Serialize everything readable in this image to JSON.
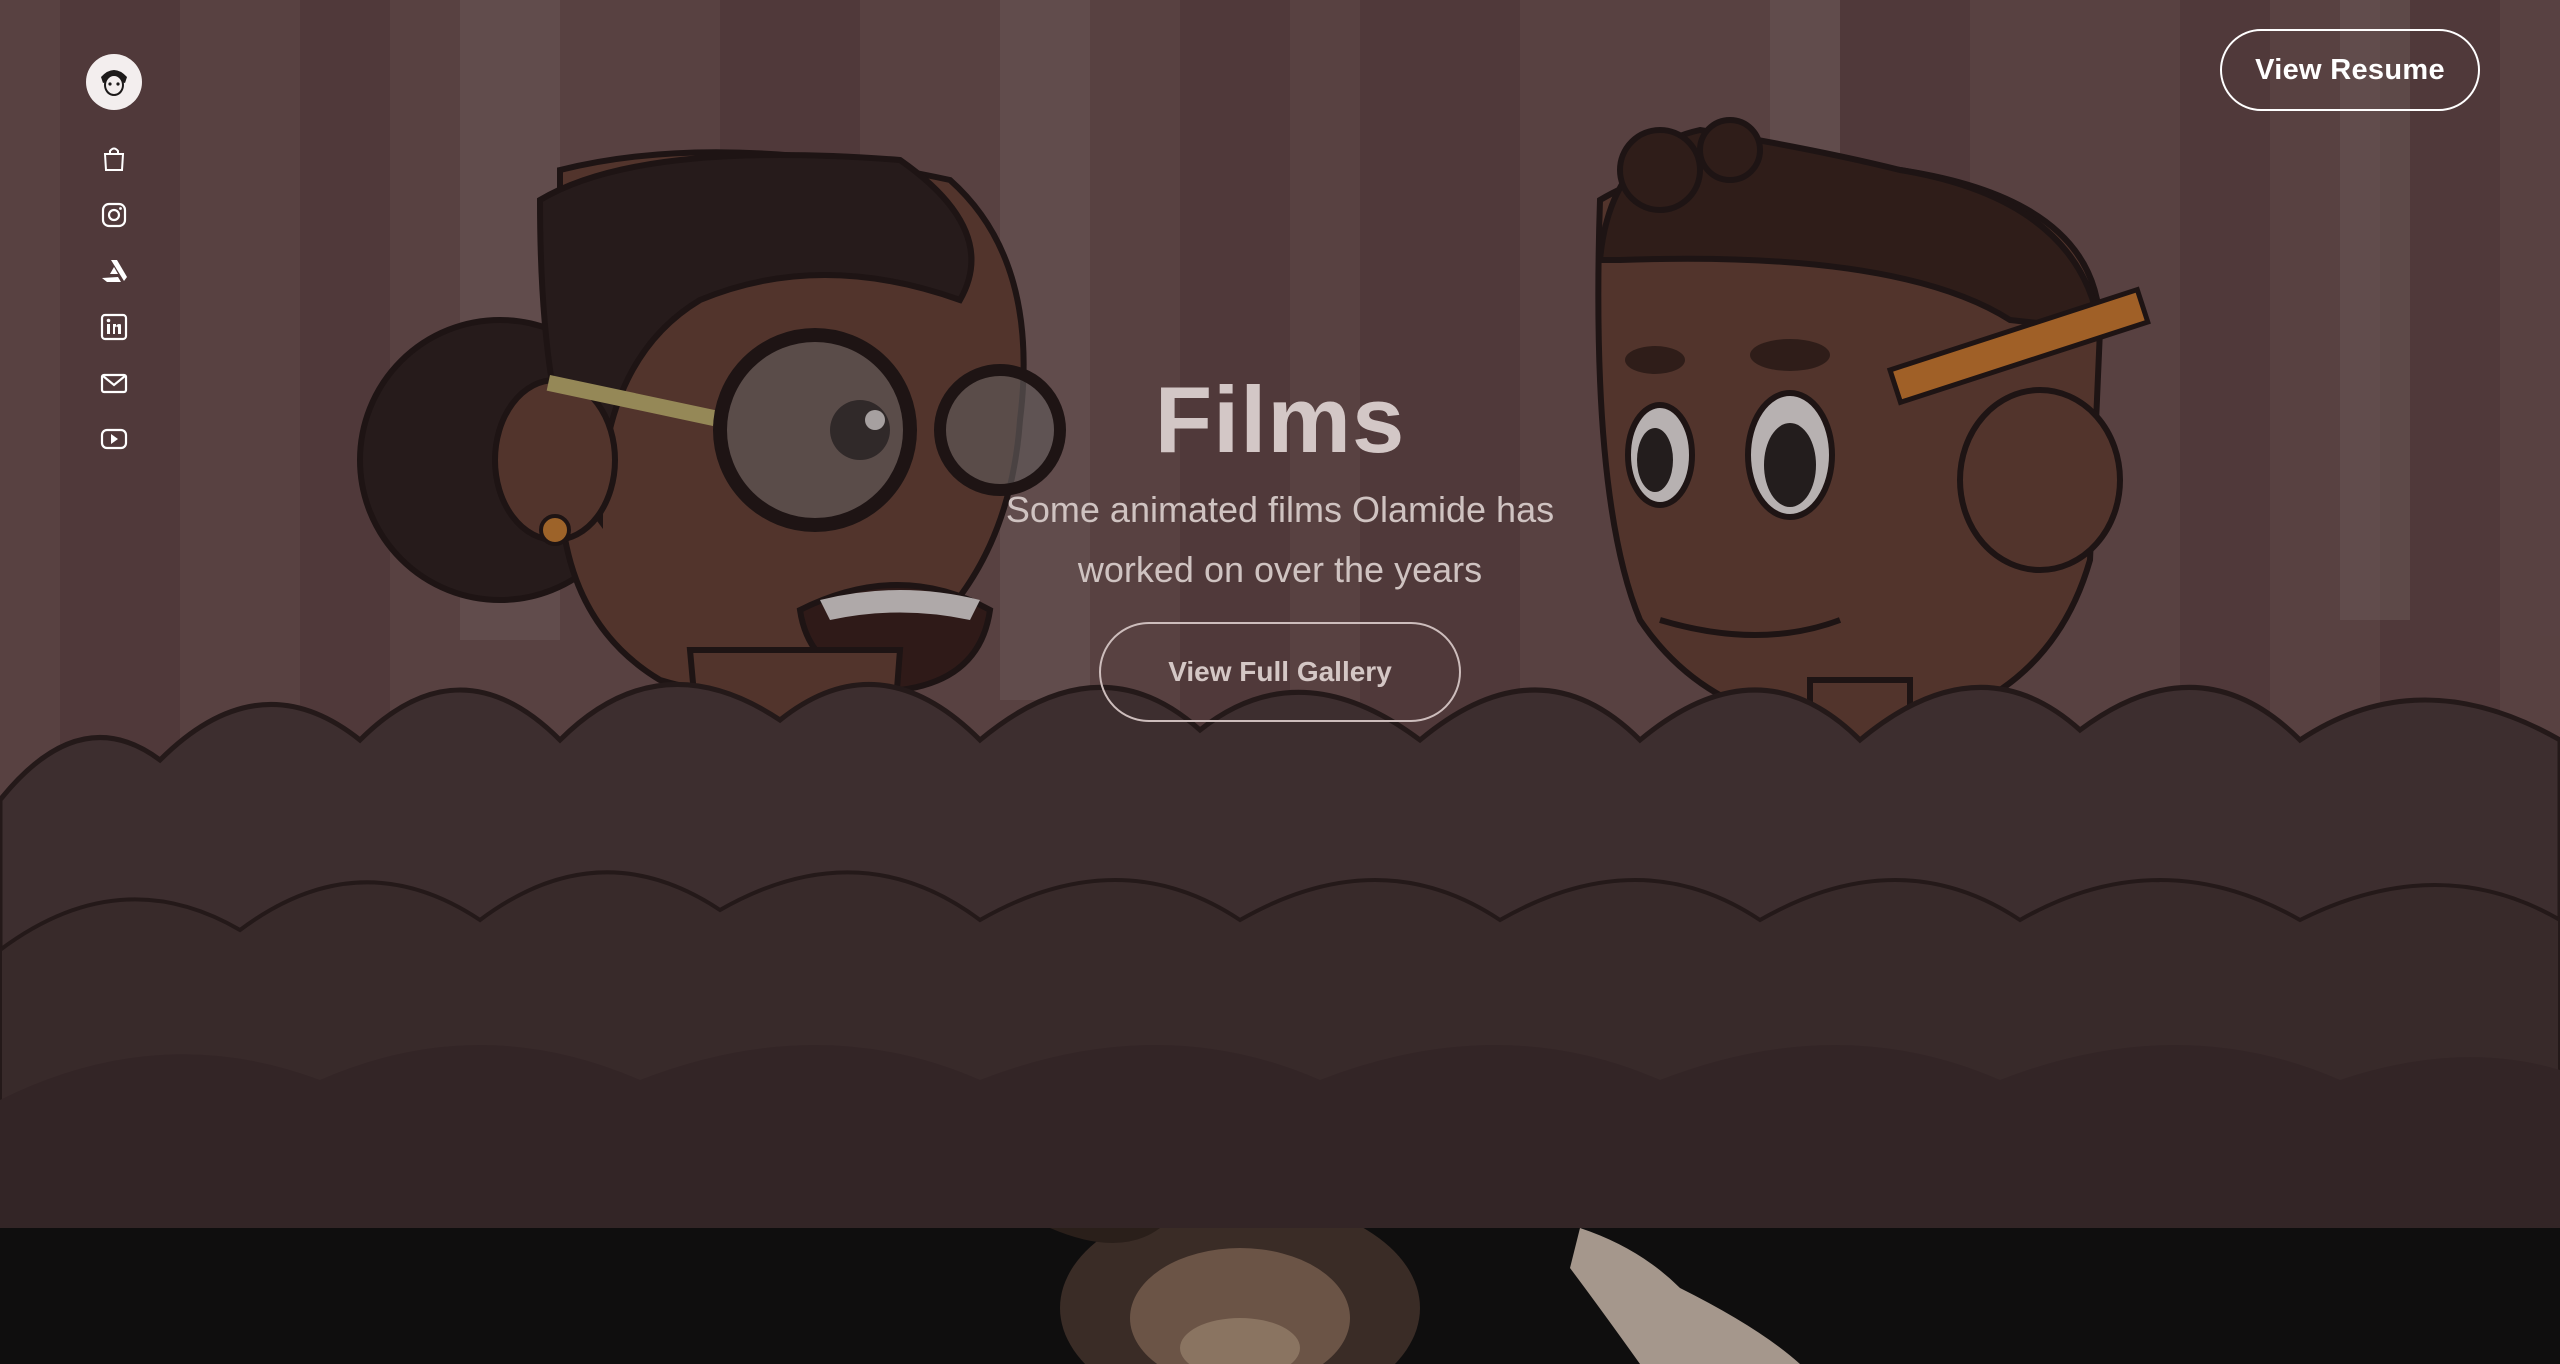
{
  "header": {
    "resume_label": "View Resume"
  },
  "side_nav": {
    "icons": [
      {
        "name": "shopping-bag-icon"
      },
      {
        "name": "instagram-icon"
      },
      {
        "name": "artstation-icon"
      },
      {
        "name": "linkedin-icon"
      },
      {
        "name": "mail-icon"
      },
      {
        "name": "youtube-icon"
      }
    ]
  },
  "hero": {
    "title": "Films",
    "subtitle": "Some animated films Olamide has worked on over the years",
    "gallery_label": "View Full Gallery"
  },
  "colors": {
    "overlay": "#5b4546",
    "text_primary": "#ffffff",
    "text_muted": "#cfc3c1",
    "page_bg": "#0f0e0e"
  }
}
